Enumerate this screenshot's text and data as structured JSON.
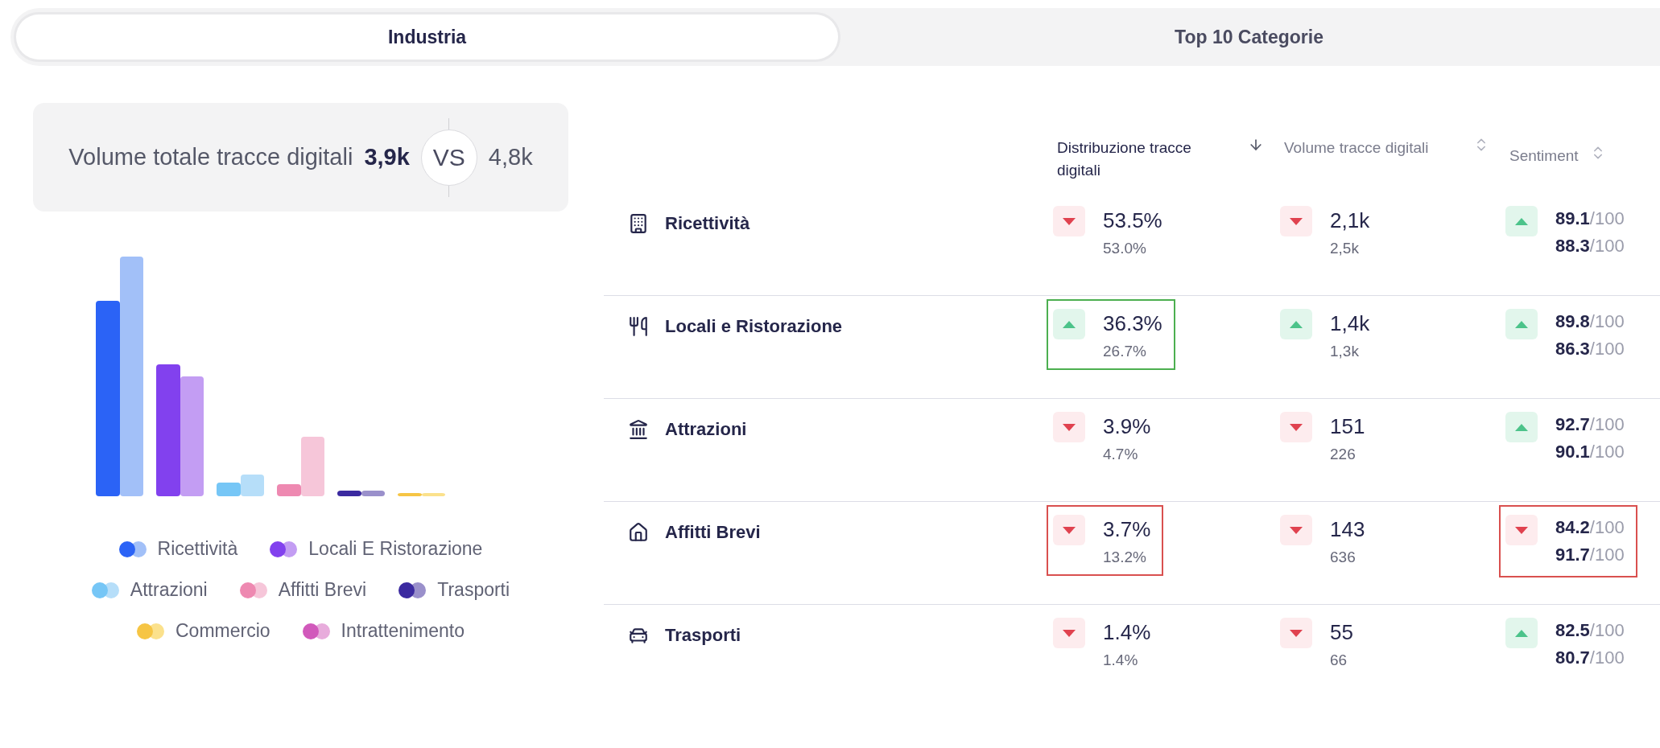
{
  "tabs": [
    {
      "label": "Industria",
      "selected": true
    },
    {
      "label": "Top 10 Categorie",
      "selected": false
    }
  ],
  "summary": {
    "label": "Volume totale tracce digitali",
    "current": "3,9k",
    "vs": "VS",
    "previous": "4,8k"
  },
  "legend": [
    {
      "label": "Ricettività",
      "dots": [
        {
          "color": "#2b63f6"
        },
        {
          "color": "#a2c0f8"
        }
      ]
    },
    {
      "label": "Locali E Ristorazione",
      "dots": [
        {
          "color": "#8241ee"
        },
        {
          "color": "#c39df3"
        }
      ]
    },
    {
      "label": "Attrazioni",
      "dots": [
        {
          "color": "#76c6f6"
        },
        {
          "color": "#b6def9"
        }
      ]
    },
    {
      "label": "Affitti Brevi",
      "dots": [
        {
          "color": "#ee89b1"
        },
        {
          "color": "#f6c6d9"
        }
      ]
    },
    {
      "label": "Trasporti",
      "dots": [
        {
          "color": "#3b2aa0"
        },
        {
          "color": "#9a90cb"
        }
      ]
    },
    {
      "label": "Commercio",
      "dots": [
        {
          "color": "#f6c544"
        },
        {
          "color": "#fbe18c"
        }
      ]
    },
    {
      "label": "Intrattenimento",
      "dots": [
        {
          "color": "#d159bb"
        },
        {
          "color": "#e8acdc"
        }
      ]
    }
  ],
  "table": {
    "columns": [
      {
        "label": "Distribuzione tracce digitali",
        "sorted": true
      },
      {
        "label": "Volume tracce digitali",
        "sorted": false
      },
      {
        "label": "Sentiment",
        "sorted": false
      }
    ],
    "rows": [
      {
        "name": "Ricettività",
        "distribution": {
          "up": false,
          "current": "53.5%",
          "previous": "53.0%",
          "outlined": false
        },
        "volume": {
          "up": false,
          "current": "2,1k",
          "previous": "2,5k"
        },
        "sentiment": {
          "up": true,
          "current": "89.1",
          "current_max": "/100",
          "previous": "88.3",
          "previous_max": "/100",
          "outlined": false
        }
      },
      {
        "name": "Locali e Ristorazione",
        "distribution": {
          "up": true,
          "current": "36.3%",
          "previous": "26.7%",
          "outlined": true
        },
        "volume": {
          "up": true,
          "current": "1,4k",
          "previous": "1,3k"
        },
        "sentiment": {
          "up": true,
          "current": "89.8",
          "current_max": "/100",
          "previous": "86.3",
          "previous_max": "/100",
          "outlined": false
        }
      },
      {
        "name": "Attrazioni",
        "distribution": {
          "up": false,
          "current": "3.9%",
          "previous": "4.7%",
          "outlined": false
        },
        "volume": {
          "up": false,
          "current": "151",
          "previous": "226"
        },
        "sentiment": {
          "up": true,
          "current": "92.7",
          "current_max": "/100",
          "previous": "90.1",
          "previous_max": "/100",
          "outlined": false
        }
      },
      {
        "name": "Affitti Brevi",
        "distribution": {
          "up": false,
          "current": "3.7%",
          "previous": "13.2%",
          "outlined": true
        },
        "volume": {
          "up": false,
          "current": "143",
          "previous": "636"
        },
        "sentiment": {
          "up": false,
          "current": "84.2",
          "current_max": "/100",
          "previous": "91.7",
          "previous_max": "/100",
          "outlined": true
        }
      },
      {
        "name": "Trasporti",
        "distribution": {
          "up": false,
          "current": "1.4%",
          "previous": "1.4%",
          "outlined": false
        },
        "volume": {
          "up": false,
          "current": "55",
          "previous": "66"
        },
        "sentiment": {
          "up": true,
          "current": "82.5",
          "current_max": "/100",
          "previous": "80.7",
          "previous_max": "/100",
          "outlined": false
        }
      }
    ]
  }
}
